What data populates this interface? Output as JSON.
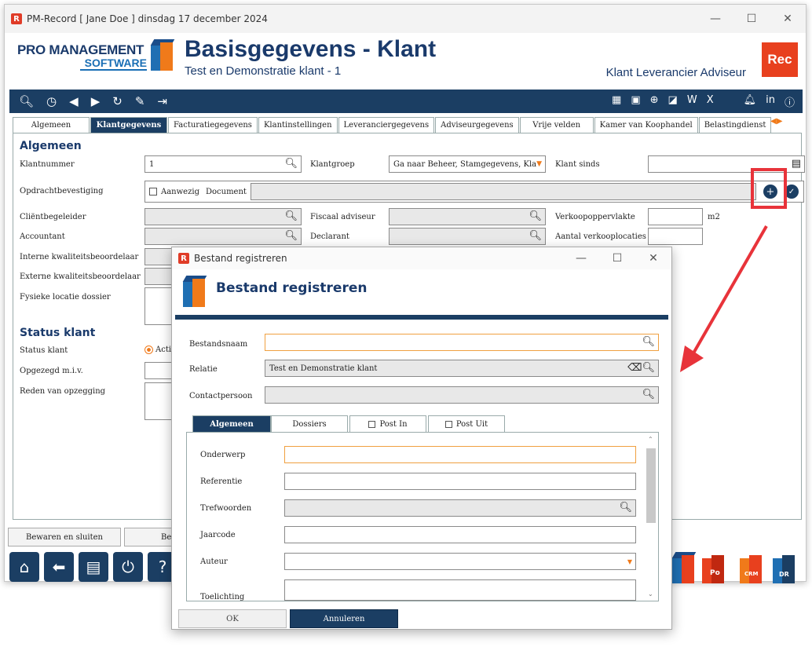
{
  "window": {
    "title": "PM-Record  [ Jane Doe ]  dinsdag 17 december 2024",
    "controls": [
      "—",
      "☐",
      "✕"
    ]
  },
  "header": {
    "logo_line1": "PRO MANAGEMENT",
    "logo_line2": "SOFTWARE",
    "title": "Basisgegevens - Klant",
    "subtitle": "Test en Demonstratie klant - 1",
    "roles": "Klant Leverancier Adviseur",
    "rec_badge": "Rec"
  },
  "tabs": [
    "Algemeen",
    "Klantgegevens",
    "Facturatiegegevens",
    "Klantinstellingen",
    "Leveranciergegevens",
    "Adviseurgegevens",
    "Vrije velden",
    "Kamer van Koophandel",
    "Belastingdienst"
  ],
  "active_tab": "Klantgegevens",
  "form": {
    "section_general": "Algemeen",
    "klantnummer_label": "Klantnummer",
    "klantnummer_value": "1",
    "klantgroep_label": "Klantgroep",
    "klantgroep_value": "Ga naar Beheer, Stamgegevens, Kla",
    "klant_sinds_label": "Klant sinds",
    "opdracht_label": "Opdrachtbevestiging",
    "aanwezig_label": "Aanwezig",
    "document_label": "Document",
    "clientbegeleider_label": "Cliëntbegeleider",
    "fiscaal_label": "Fiscaal adviseur",
    "verkoop_label": "Verkoopoppervlakte",
    "m2_label": "m2",
    "accountant_label": "Accountant",
    "declarant_label": "Declarant",
    "aantal_label": "Aantal verkooplocaties",
    "interne_label": "Interne kwaliteitsbeoordelaar",
    "externe_label": "Externe kwaliteitsbeoordelaar",
    "fysieke_label": "Fysieke locatie dossier",
    "section_status": "Status klant",
    "status_label": "Status klant",
    "status_value": "Actie",
    "opgezegd_label": "Opgezegd m.i.v.",
    "reden_label": "Reden van opzegging"
  },
  "bottom": {
    "save_close": "Bewaren en sluiten",
    "save_partial": "Be"
  },
  "bottom_icons": {
    "po": "Po",
    "crm": "CRM",
    "dr": "DR"
  },
  "dialog": {
    "title": "Bestand registreren",
    "header": "Bestand registreren",
    "bestandsnaam_label": "Bestandsnaam",
    "relatie_label": "Relatie",
    "relatie_value": "Test en Demonstratie klant",
    "contactpersoon_label": "Contactpersoon",
    "tabs": [
      "Algemeen",
      "Dossiers",
      "Post In",
      "Post Uit"
    ],
    "onderwerp_label": "Onderwerp",
    "referentie_label": "Referentie",
    "trefwoorden_label": "Trefwoorden",
    "jaarcode_label": "Jaarcode",
    "auteur_label": "Auteur",
    "toelichting_label": "Toelichting",
    "ok_label": "OK",
    "cancel_label": "Annuleren"
  },
  "colors": {
    "navy": "#1b3e63",
    "orange": "#f07a1a",
    "red_highlight": "#e8333a"
  }
}
